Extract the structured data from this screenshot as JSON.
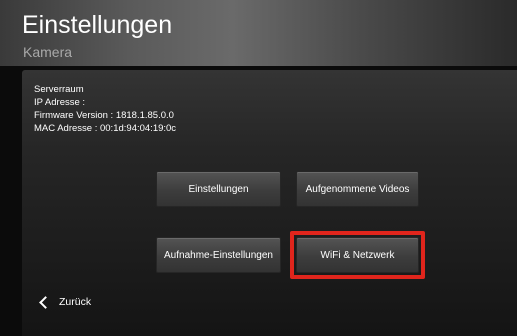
{
  "header": {
    "title": "Einstellungen",
    "subtitle": "Kamera"
  },
  "info": {
    "name": "Serverraum",
    "ip": "IP Adresse :",
    "firmware": "Firmware Version :  1818.1.85.0.0",
    "mac": "MAC Adresse :  00:1d:94:04:19:0c"
  },
  "buttons": {
    "settings": "Einstellungen",
    "videos": "Aufgenommene Videos",
    "record_settings": "Aufnahme-Einstellungen",
    "wifi": "WiFi & Netzwerk"
  },
  "nav": {
    "back": "Zurück"
  },
  "colors": {
    "highlight": "#e0251c",
    "subtitle": "#a9a9a9"
  }
}
